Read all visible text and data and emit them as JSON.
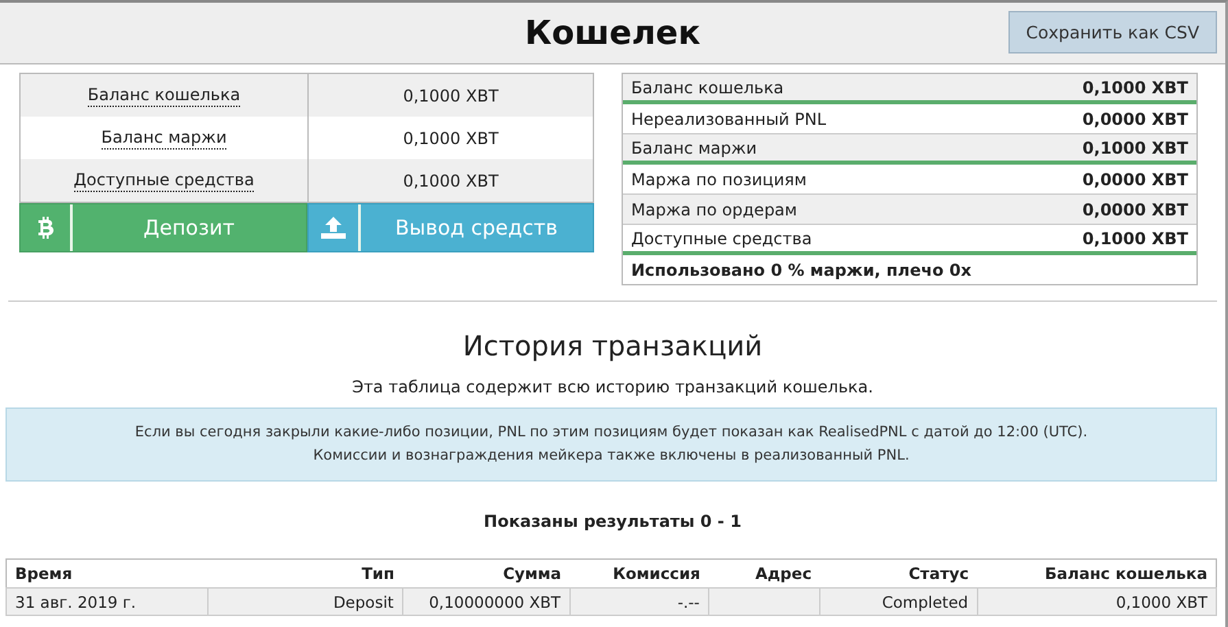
{
  "header": {
    "title": "Кошелек",
    "export_button": "Сохранить как CSV"
  },
  "summary": [
    {
      "label": "Баланс кошелька",
      "value": "0,1000 XBT"
    },
    {
      "label": "Баланс маржи",
      "value": "0,1000 XBT"
    },
    {
      "label": "Доступные средства",
      "value": "0,1000 XBT"
    }
  ],
  "actions": [
    {
      "kind": "deposit",
      "label": "Депозит"
    },
    {
      "kind": "withdraw",
      "label": "Вывод средств"
    }
  ],
  "breakdown": [
    {
      "label": "Баланс кошелька",
      "value": "0,1000 XBT",
      "divider_below": true
    },
    {
      "label": "Нереализованный PNL",
      "value": "0,0000 XBT",
      "divider_below": false
    },
    {
      "label": "Баланс маржи",
      "value": "0,1000 XBT",
      "divider_below": true
    },
    {
      "label": "Маржа по позициям",
      "value": "0,0000 XBT",
      "divider_below": false
    },
    {
      "label": "Маржа по ордерам",
      "value": "0,0000 XBT",
      "divider_below": false
    },
    {
      "label": "Доступные средства",
      "value": "0,1000 XBT",
      "divider_below": true
    }
  ],
  "usage_note": "Использовано 0 % маржи, плечо 0x",
  "history": {
    "title": "История транзакций",
    "subtitle": "Эта таблица содержит всю историю транзакций кошелька.",
    "notice": [
      "Если вы сегодня закрыли какие-либо позиции, PNL по этим позициям будет показан как RealisedPNL с датой до 12:00 (UTC).",
      "Комиссии и вознаграждения мейкера также включены в реализованный PNL."
    ],
    "results": "Показаны результаты 0 - 1"
  },
  "table": {
    "columns": [
      "Время",
      "Тип",
      "Сумма",
      "Комиссия",
      "Адрес",
      "Статус",
      "Баланс кошелька"
    ],
    "rows": [
      [
        "31 авг. 2019 г.",
        "Deposit",
        "0,10000000 XBT",
        "-.--",
        "",
        "Completed",
        "0,1000 XBT"
      ]
    ]
  }
}
